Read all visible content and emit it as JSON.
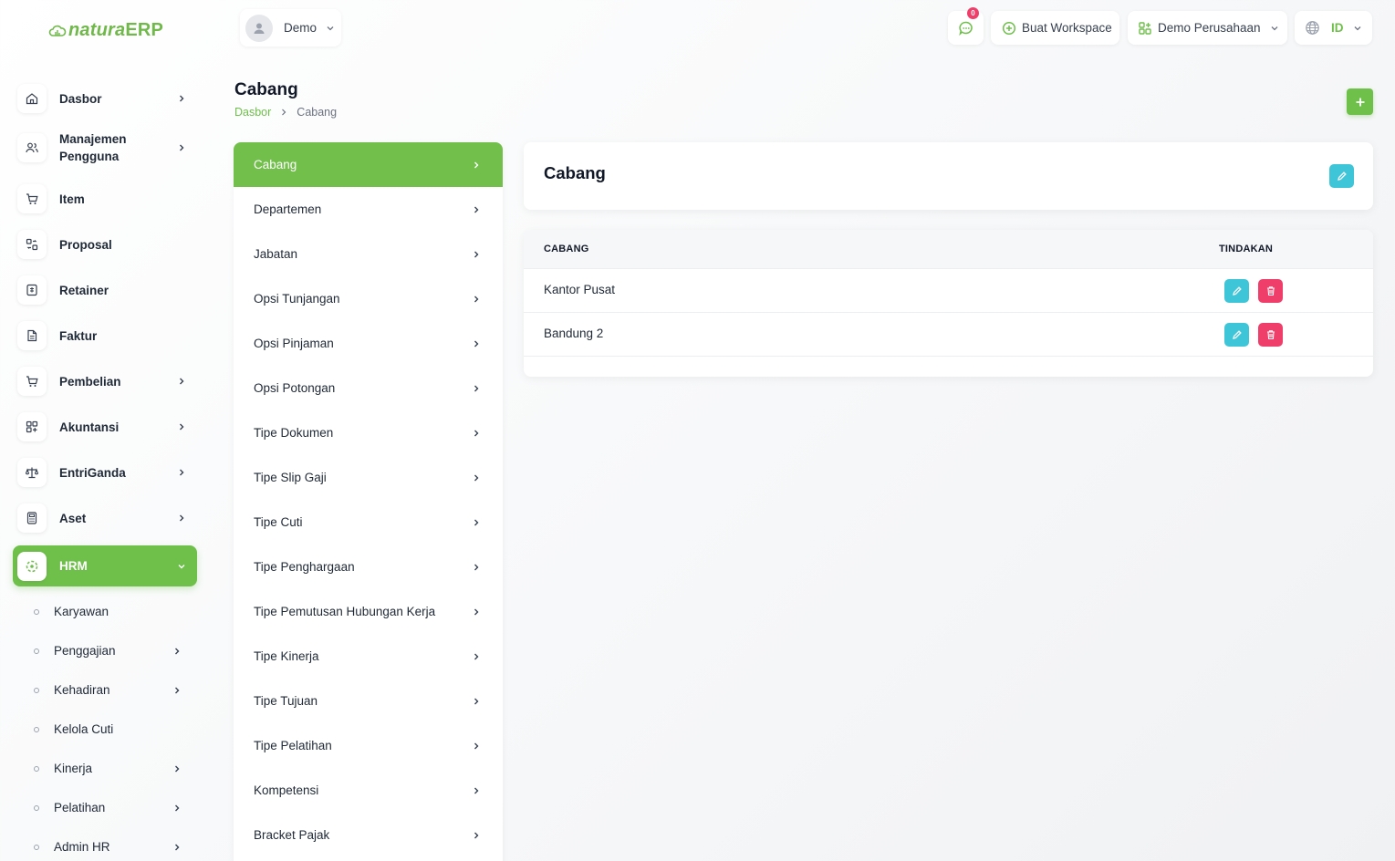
{
  "app": {
    "logo_prefix": "natura",
    "logo_suffix": "ERP"
  },
  "colors": {
    "brand_green": "#6fbf4b",
    "edit_teal": "#3ec6d8",
    "delete_pink": "#ef3e6a"
  },
  "topbar": {
    "user": "Demo",
    "notifications_count": "0",
    "workspace_button": "Buat Workspace",
    "company": "Demo Perusahaan",
    "language": "ID"
  },
  "sidebar": {
    "items": [
      {
        "label": "Dasbor",
        "icon": "home-icon",
        "chevron": true
      },
      {
        "label": "Manajemen Pengguna",
        "icon": "users-icon",
        "chevron": true
      },
      {
        "label": "Item",
        "icon": "cart-icon",
        "chevron": false
      },
      {
        "label": "Proposal",
        "icon": "proposal-icon",
        "chevron": false
      },
      {
        "label": "Retainer",
        "icon": "retainer-icon",
        "chevron": false
      },
      {
        "label": "Faktur",
        "icon": "invoice-icon",
        "chevron": false
      },
      {
        "label": "Pembelian",
        "icon": "cart-icon",
        "chevron": true
      },
      {
        "label": "Akuntansi",
        "icon": "grid-plus-icon",
        "chevron": true
      },
      {
        "label": "EntriGanda",
        "icon": "scale-icon",
        "chevron": true
      },
      {
        "label": "Aset",
        "icon": "calculator-icon",
        "chevron": true
      }
    ],
    "active": {
      "label": "HRM",
      "icon": "hrm-icon"
    },
    "sub_items": [
      {
        "label": "Karyawan",
        "chevron": false
      },
      {
        "label": "Penggajian",
        "chevron": true
      },
      {
        "label": "Kehadiran",
        "chevron": true
      },
      {
        "label": "Kelola Cuti",
        "chevron": false
      },
      {
        "label": "Kinerja",
        "chevron": true
      },
      {
        "label": "Pelatihan",
        "chevron": true
      },
      {
        "label": "Admin HR",
        "chevron": true
      }
    ]
  },
  "page": {
    "title": "Cabang",
    "breadcrumb": {
      "home": "Dasbor",
      "current": "Cabang"
    }
  },
  "settings_menu": [
    "Cabang",
    "Departemen",
    "Jabatan",
    "Opsi Tunjangan",
    "Opsi Pinjaman",
    "Opsi Potongan",
    "Tipe Dokumen",
    "Tipe Slip Gaji",
    "Tipe Cuti",
    "Tipe Penghargaan",
    "Tipe Pemutusan Hubungan Kerja",
    "Tipe Kinerja",
    "Tipe Tujuan",
    "Tipe Pelatihan",
    "Kompetensi",
    "Bracket Pajak"
  ],
  "settings_menu_active": 0,
  "content": {
    "card_title": "Cabang",
    "table": {
      "headers": {
        "name": "CABANG",
        "actions": "TINDAKAN"
      },
      "rows": [
        {
          "name": "Kantor Pusat"
        },
        {
          "name": "Bandung 2"
        }
      ]
    }
  }
}
